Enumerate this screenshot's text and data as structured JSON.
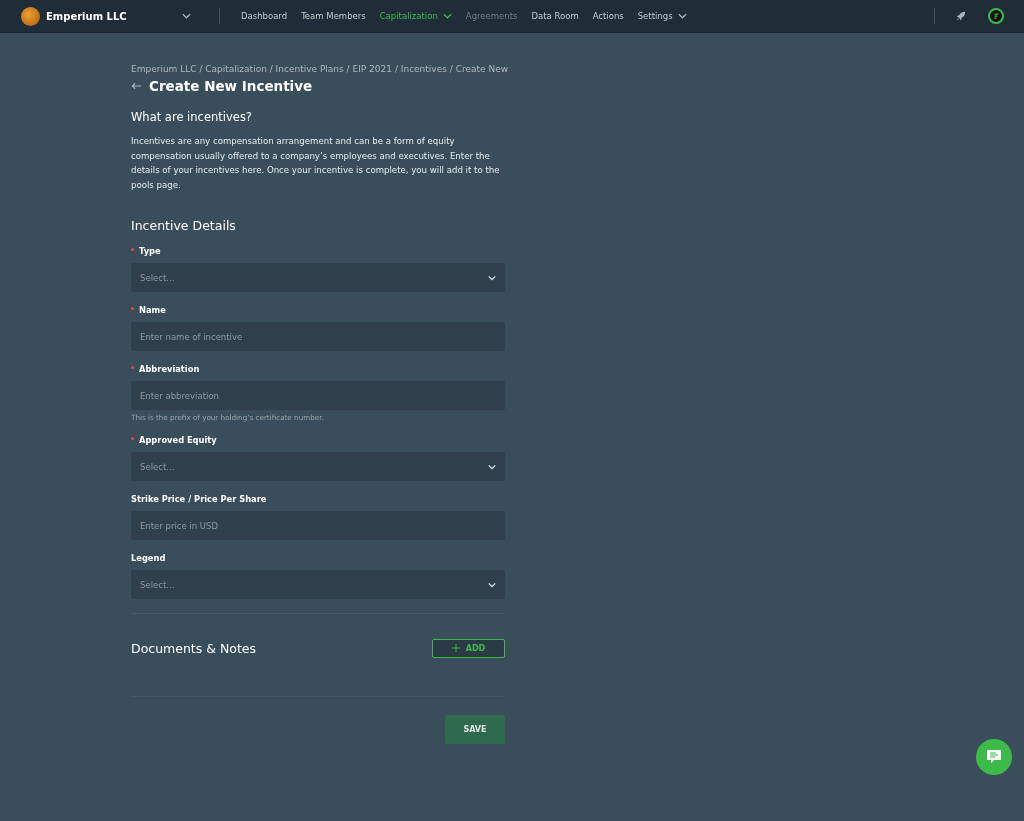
{
  "topbar": {
    "company": "Emperium LLC",
    "nav": [
      {
        "label": "Dashboard",
        "selected": false,
        "disabled": false,
        "dropdown": false
      },
      {
        "label": "Team Members",
        "selected": false,
        "disabled": false,
        "dropdown": false
      },
      {
        "label": "Capitalization",
        "selected": true,
        "disabled": false,
        "dropdown": true
      },
      {
        "label": "Agreements",
        "selected": false,
        "disabled": true,
        "dropdown": false
      },
      {
        "label": "Data Room",
        "selected": false,
        "disabled": false,
        "dropdown": false
      },
      {
        "label": "Actions",
        "selected": false,
        "disabled": false,
        "dropdown": false
      },
      {
        "label": "Settings",
        "selected": false,
        "disabled": false,
        "dropdown": true
      }
    ]
  },
  "breadcrumb": "Emperium LLC / Capitalization / Incentive Plans / EIP 2021 / Incentives / Create New",
  "title": "Create New Incentive",
  "intro": {
    "heading": "What are incentives?",
    "text": "Incentives are any compensation arrangement and can be a form of equity compensation usually offered to a company’s employees and executives. Enter the details of your incentives here. Once your incentive is complete, you will add it to the pools page."
  },
  "details": {
    "heading": "Incentive Details",
    "fields": [
      {
        "label": "Type",
        "kind": "select",
        "required": true,
        "placeholder": "Select..."
      },
      {
        "label": "Name",
        "kind": "text",
        "required": true,
        "placeholder": "Enter name of incentive"
      },
      {
        "label": "Abbreviation",
        "kind": "text",
        "required": true,
        "placeholder": "Enter abbreviation",
        "help": "This is the prefix of your holding’s certificate number."
      },
      {
        "label": "Approved Equity",
        "kind": "select",
        "required": true,
        "placeholder": "Select..."
      },
      {
        "label": "Strike Price / Price Per Share",
        "kind": "text",
        "required": false,
        "placeholder": "Enter price in USD"
      },
      {
        "label": "Legend",
        "kind": "select",
        "required": false,
        "placeholder": "Select..."
      }
    ]
  },
  "documents": {
    "heading": "Documents & Notes",
    "add_button": "ADD"
  },
  "save_button": "SAVE"
}
